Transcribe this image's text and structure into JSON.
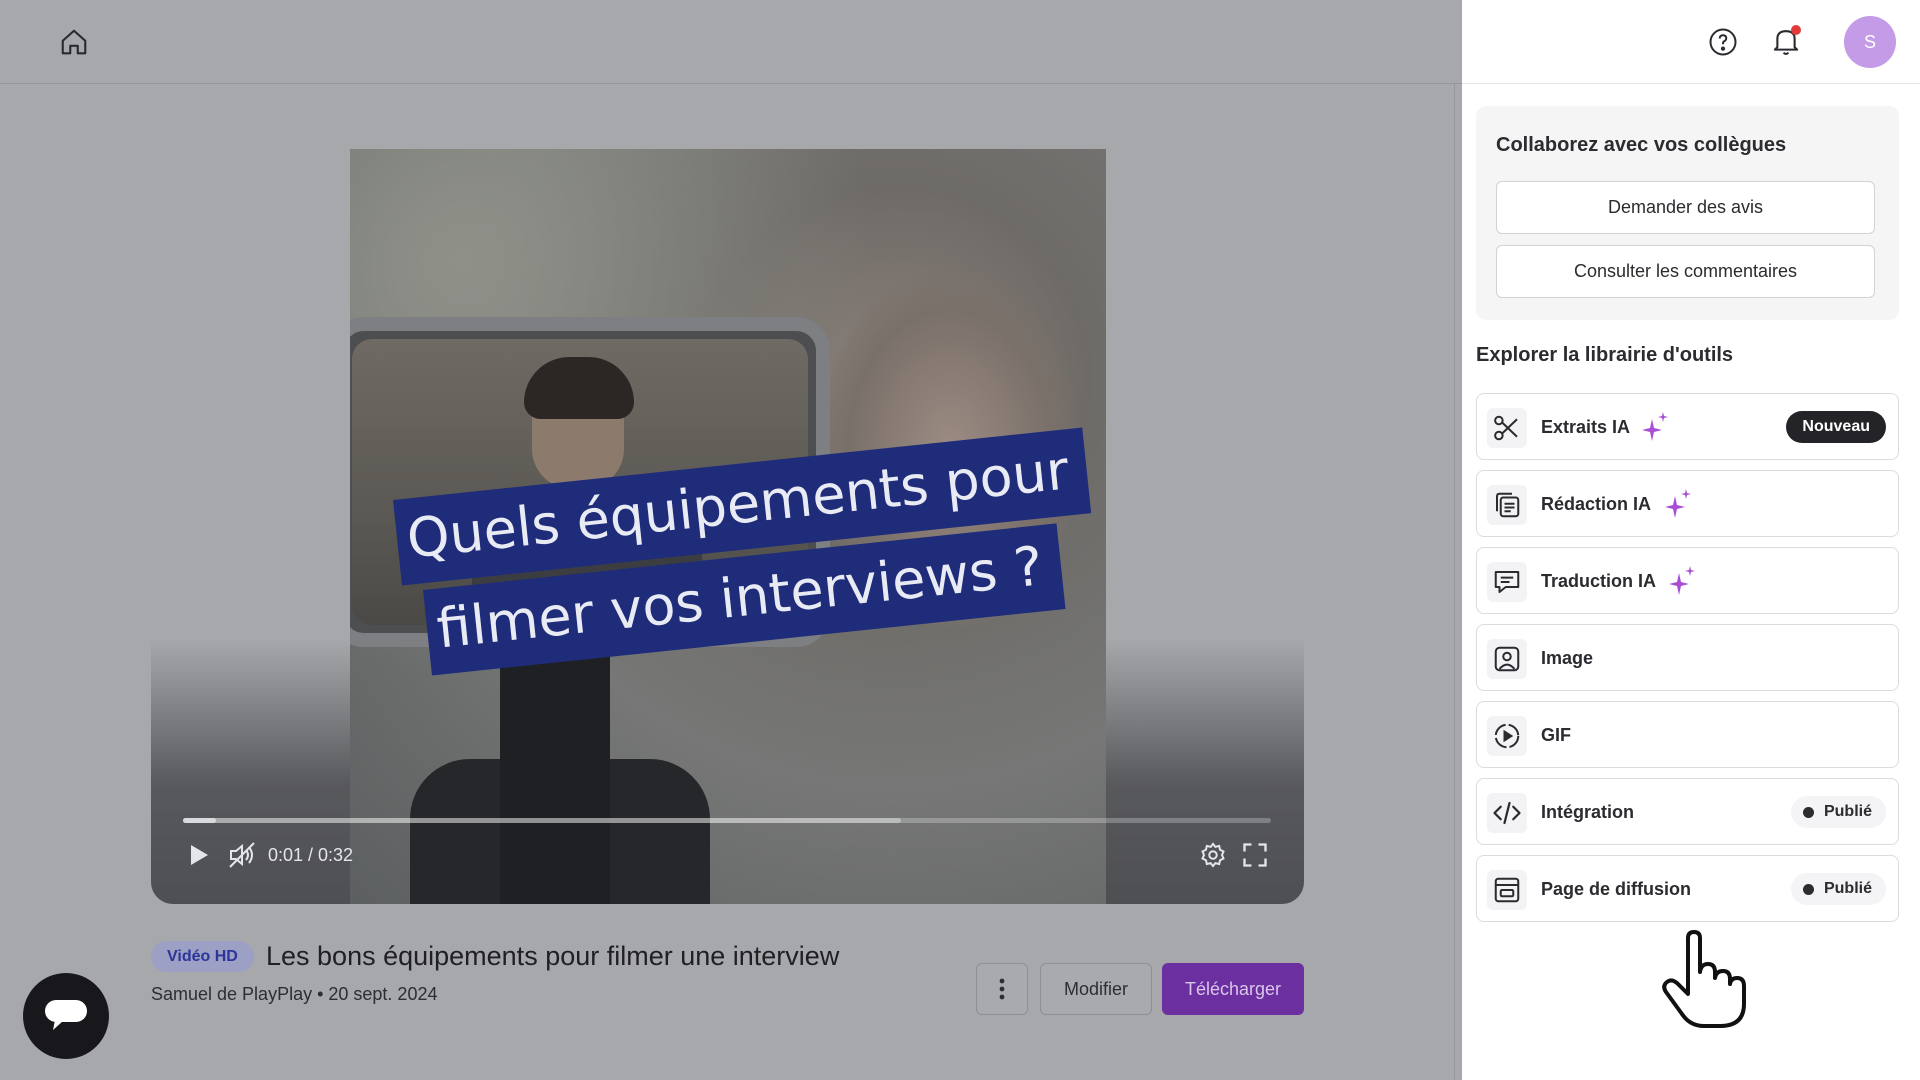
{
  "video": {
    "caption_line1": "Quels équipements pour",
    "caption_line2": "filmer vos interviews ?",
    "time": "0:01 / 0:32",
    "played_fraction": 0.03,
    "buffered_fraction": 0.66
  },
  "meta": {
    "badge": "Vidéo HD",
    "title": "Les bons équipements pour filmer une interview",
    "subtitle": "Samuel de PlayPlay • 20 sept. 2024",
    "edit_label": "Modifier",
    "download_label": "Télécharger"
  },
  "header": {
    "avatar_initial": "S"
  },
  "collab": {
    "title": "Collaborez avec vos collègues",
    "ask_feedback": "Demander des avis",
    "view_comments": "Consulter les commentaires"
  },
  "tools": {
    "title": "Explorer la librairie d'outils",
    "items": [
      {
        "label": "Extraits IA",
        "icon": "scissors-icon",
        "sparkle": true,
        "badge": "Nouveau"
      },
      {
        "label": "Rédaction IA",
        "icon": "document-copy-icon",
        "sparkle": true
      },
      {
        "label": "Traduction IA",
        "icon": "chat-bubble-icon",
        "sparkle": true
      },
      {
        "label": "Image",
        "icon": "image-icon"
      },
      {
        "label": "GIF",
        "icon": "gif-play-icon"
      },
      {
        "label": "Intégration",
        "icon": "code-icon",
        "status": "Publié"
      },
      {
        "label": "Page de diffusion",
        "icon": "browser-page-icon",
        "status": "Publié"
      }
    ]
  },
  "colors": {
    "accent": "#6c2fa0",
    "sparkle": "#a94fd6",
    "avatar": "#c49be6",
    "caption_bg": "#1f2c7a",
    "notification_dot": "#e23a3a"
  }
}
